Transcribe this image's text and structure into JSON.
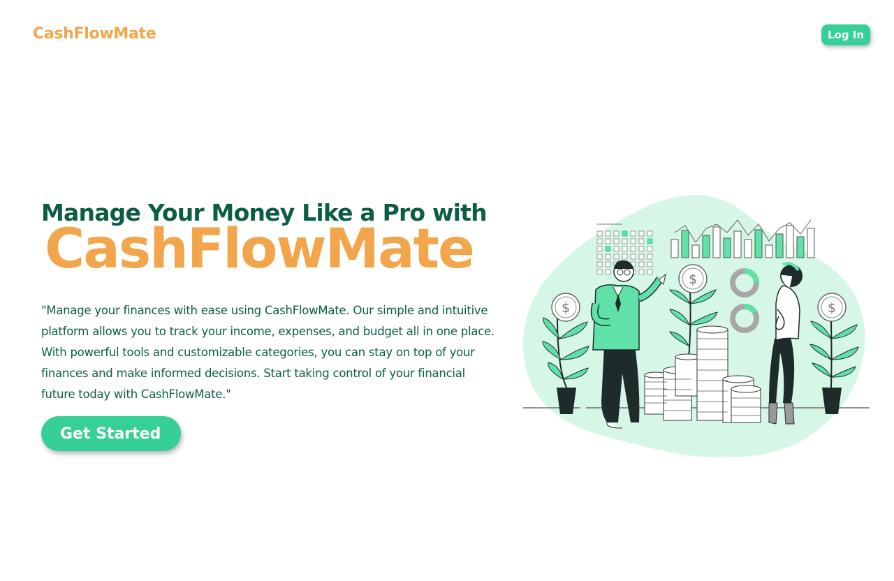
{
  "header": {
    "brand": "CashFlowMate",
    "login_label": "Log In"
  },
  "hero": {
    "headline": "Manage Your Money Like a Pro with",
    "brand_large": "CashFlowMate",
    "description": "\"Manage your finances with ease using CashFlowMate. Our simple and intuitive platform allows you to track your income, expenses, and budget all in one place. With powerful tools and customizable categories, you can stay on top of your finances and make informed decisions. Start taking control of your financial future today with CashFlowMate.\"",
    "cta_label": "Get Started"
  },
  "colors": {
    "brand_orange": "#f2a54a",
    "accent_green": "#35cf97",
    "heading_green": "#0b5e44",
    "blob_green": "#d6f7e6",
    "dark_ink": "#1d2b2b"
  },
  "illustration": {
    "icons": [
      "dollar-coin-icon",
      "plant-icon",
      "coin-stack-icon",
      "bar-chart-icon",
      "donut-chart-icon",
      "businessman-figure",
      "woman-figure"
    ]
  }
}
